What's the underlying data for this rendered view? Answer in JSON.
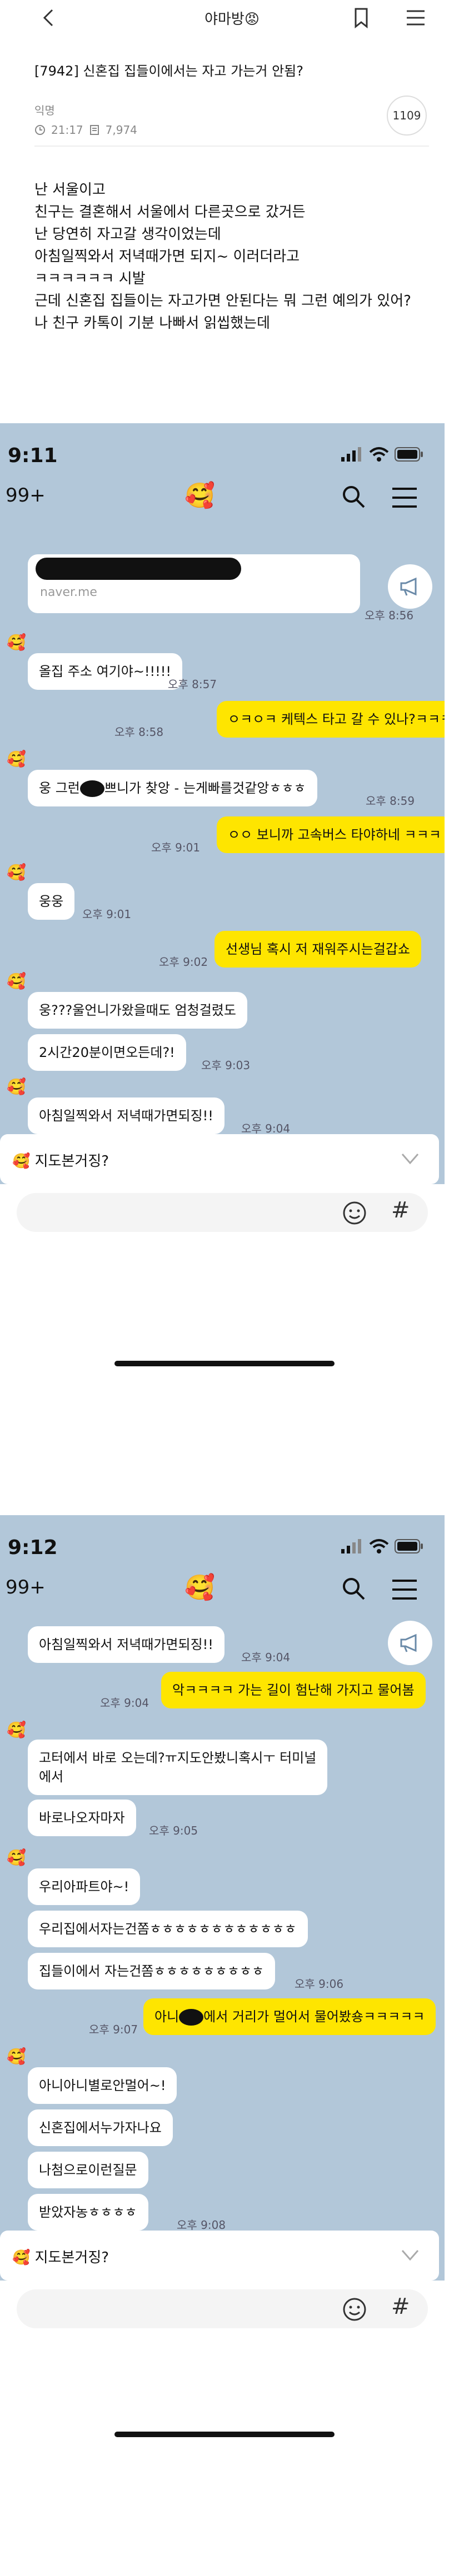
{
  "header": {
    "title": "야마방😡",
    "back_icon": "back-icon",
    "bookmark_icon": "bookmark-icon",
    "menu_icon": "menu-icon"
  },
  "post": {
    "title": "[7942] 신혼집 집들이에서는 자고 가는거 안됨?",
    "author": "익명",
    "time": "21:17",
    "views": "7,974",
    "comments": "1109",
    "body": [
      "난 서울이고",
      "친구는 결혼해서 서울에서 다른곳으로 갔거든",
      "",
      "난 당연히 자고갈 생각이었는데",
      "아침일찍와서 저녁때가면 되지~ 이러더라고",
      "ㅋㅋㅋㅋㅋㅋ 시발",
      "근데 신혼집 집들이는 자고가면 안된다는 뭐 그런 예의가 있어?",
      "나 친구 카톡이 기분 나빠서 읽씹했는데"
    ]
  },
  "chat1": {
    "status_time": "9:11",
    "back_count": "99+",
    "title_emoji": "🥰",
    "link_url": "naver.me",
    "link_time": "오후 8:56",
    "messages": [
      {
        "side": "them",
        "text": "올집 주소 여기야~!!!!!",
        "time": "오후 8:57"
      },
      {
        "side": "me",
        "text": "ㅇㅋㅇㅋ 케텍스 타고 갈 수 있나?ㅋㅋㅋ",
        "time": "오후 8:58"
      },
      {
        "side": "them",
        "text_a": "웅 그런",
        "text_b": "쁘니가 찾앙 - 는게빠를것같앙ㅎㅎㅎ",
        "time": "오후 8:59"
      },
      {
        "side": "me",
        "text": "ㅇㅇ 보니까 고속버스 타야하네 ㅋㅋㅋ",
        "time": "오후 9:01"
      },
      {
        "side": "them",
        "text": "웅웅",
        "time": "오후 9:01"
      },
      {
        "side": "me",
        "text": "선생님 혹시 저 재워주시는걸갑쇼",
        "time": "오후 9:02"
      },
      {
        "side": "them",
        "text": "웅???울언니가왔을때도 엄청걸렸도",
        "time": ""
      },
      {
        "side": "them",
        "text": "2시간20분이면오든데?!",
        "time": "오후 9:03"
      },
      {
        "side": "them",
        "text": "아침일찍와서 저녁때가면되징!!",
        "time": "오후 9:04"
      }
    ],
    "suggest": "지도본거징?"
  },
  "chat2": {
    "status_time": "9:12",
    "back_count": "99+",
    "title_emoji": "🥰",
    "messages": [
      {
        "side": "them",
        "text": "아침일찍와서 저녁때가면되징!!",
        "time": "오후 9:04"
      },
      {
        "side": "me",
        "text": "악ㅋㅋㅋㅋ 가는 길이 험난해 가지고 물어봄",
        "time": "오후 9:04"
      },
      {
        "side": "them",
        "text": "고터에서 바로 오는데?ㅠ지도안봤니혹시ㅜ 터미널\n에서",
        "time": ""
      },
      {
        "side": "them",
        "text": "바로나오자마자",
        "time": "오후 9:05"
      },
      {
        "side": "them",
        "text": "우리아파트야~!",
        "time": ""
      },
      {
        "side": "them",
        "text": "우리집에서자는건쫌ㅎㅎㅎㅎㅎㅎㅎㅎㅎㅎㅎㅎ",
        "time": ""
      },
      {
        "side": "them",
        "text": "집들이에서 자는건쫌ㅎㅎㅎㅎㅎㅎㅎㅎㅎ",
        "time": "오후 9:06"
      },
      {
        "side": "me",
        "text_a": "아니",
        "text_b": "에서 거리가 멀어서 물어봤숑ㅋㅋㅋㅋㅋ",
        "time": "오후 9:07"
      },
      {
        "side": "them",
        "text": "아니아니별로안멀어~!",
        "time": ""
      },
      {
        "side": "them",
        "text": "신혼집에서누가자나요",
        "time": ""
      },
      {
        "side": "them",
        "text": "나첨으로이런질문",
        "time": ""
      },
      {
        "side": "them",
        "text": "받았자농ㅎㅎㅎㅎ",
        "time": "오후 9:08"
      }
    ],
    "suggest": "지도본거징?"
  },
  "icons": [
    "back-icon",
    "bookmark-icon",
    "menu-icon",
    "clock-icon",
    "views-icon",
    "signal-icon",
    "wifi-icon",
    "battery-icon",
    "search-icon",
    "hamburger-icon",
    "megaphone-icon",
    "chevron-down-icon",
    "emoji-icon",
    "hash-icon"
  ]
}
